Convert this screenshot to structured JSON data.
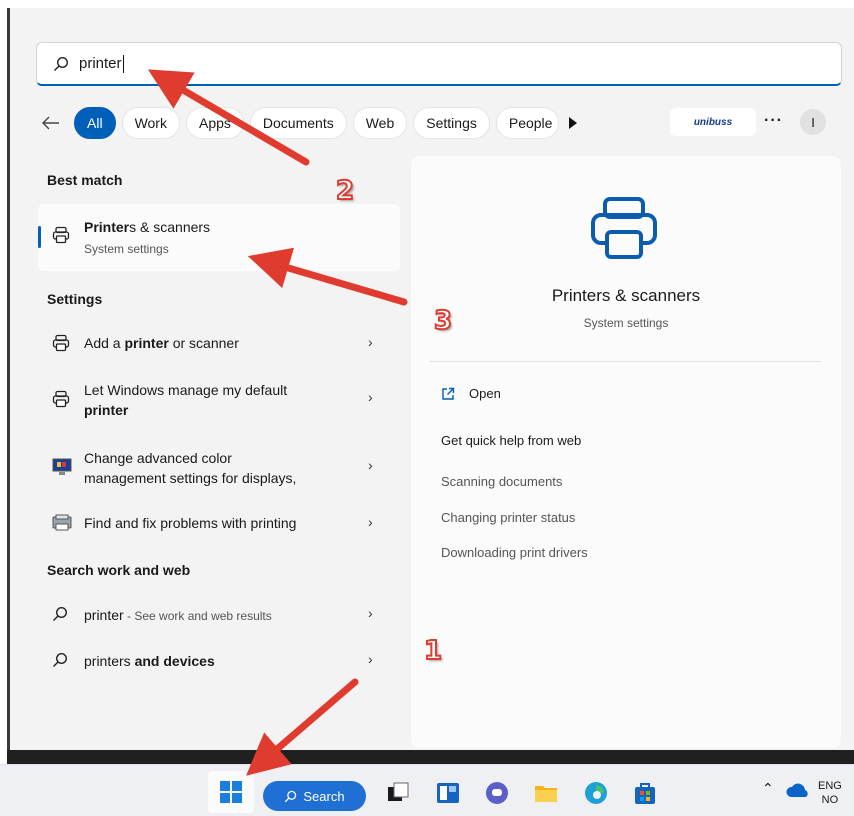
{
  "search": {
    "query": "printer"
  },
  "filters": {
    "chips": [
      "All",
      "Work",
      "Apps",
      "Documents",
      "Web",
      "Settings",
      "People"
    ],
    "brand": "unibuss",
    "more": "···",
    "avatar": "I"
  },
  "sections": {
    "best_match": "Best match",
    "settings": "Settings",
    "search_web": "Search work and web"
  },
  "best_match": {
    "title_bold": "Printer",
    "title_rest": "s & scanners",
    "subtitle": "System settings"
  },
  "settings_items": [
    {
      "pre": "Add a ",
      "bold": "printer",
      "post": " or scanner"
    },
    {
      "pre": "Let Windows manage my default",
      "bold": "printer",
      "post": ""
    },
    {
      "line1": "Change advanced color",
      "line2": "management settings for displays,"
    },
    {
      "label": "Find and fix problems with printing"
    }
  ],
  "web_items": [
    {
      "bold_query": "printer",
      "suffix": " - See work and web results"
    },
    {
      "pre": "printers",
      "bold": " and devices"
    }
  ],
  "detail": {
    "title": "Printers & scanners",
    "subtitle": "System settings",
    "open": "Open",
    "help_heading": "Get quick help from web",
    "links": [
      "Scanning documents",
      "Changing printer status",
      "Downloading print drivers"
    ]
  },
  "taskbar": {
    "search_label": "Search",
    "lang1": "ENG",
    "lang2": "NO"
  },
  "annotations": [
    "2",
    "3",
    "1"
  ],
  "colors": {
    "accent": "#005fb8",
    "arrow": "#e03b2f"
  }
}
